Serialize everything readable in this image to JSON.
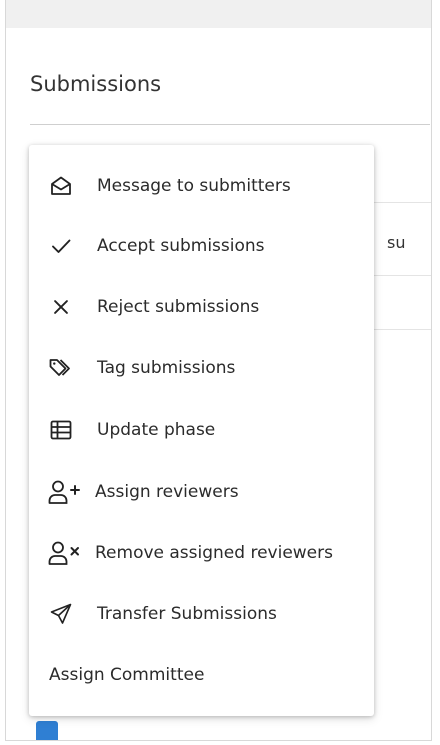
{
  "page": {
    "title": "Submissions"
  },
  "background": {
    "peek_text": "su"
  },
  "menu": {
    "items": [
      {
        "label": "Message to submitters",
        "icon": "envelope-open-icon"
      },
      {
        "label": "Accept submissions",
        "icon": "check-icon"
      },
      {
        "label": "Reject submissions",
        "icon": "close-icon"
      },
      {
        "label": "Tag submissions",
        "icon": "tag-icon"
      },
      {
        "label": "Update phase",
        "icon": "table-icon"
      },
      {
        "label": "Assign reviewers",
        "icon": "user-plus-icon"
      },
      {
        "label": "Remove assigned reviewers",
        "icon": "user-remove-icon"
      },
      {
        "label": "Transfer Submissions",
        "icon": "send-icon"
      },
      {
        "label": "Assign Committee",
        "icon": ""
      }
    ]
  }
}
